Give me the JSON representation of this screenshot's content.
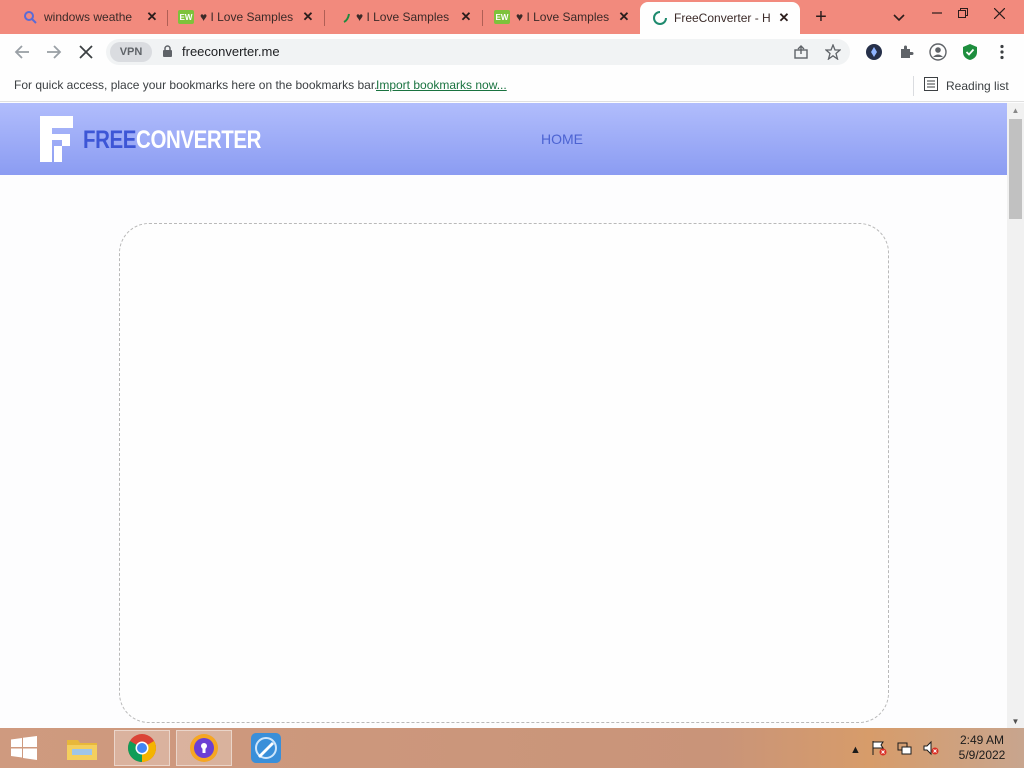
{
  "browser": {
    "tabs": [
      {
        "title": "windows weathe",
        "icon": "search-icon",
        "active": false
      },
      {
        "title": "♥ I Love Samples",
        "icon": "ew-icon",
        "badge": "EW",
        "active": false
      },
      {
        "title": "♥ I Love Samples",
        "icon": "loading-icon",
        "active": false
      },
      {
        "title": "♥ I Love Samples",
        "icon": "ew-icon",
        "badge": "EW",
        "active": false
      },
      {
        "title": "FreeConverter - H",
        "icon": "loading-icon",
        "active": true
      }
    ],
    "new_tab": "+",
    "url": "freeconverter.me",
    "vpn_label": "VPN"
  },
  "bookmarks_bar": {
    "message": "For quick access, place your bookmarks here on the bookmarks bar.",
    "import_link": "Import bookmarks now...",
    "reading_list": "Reading list"
  },
  "site": {
    "logo_free": "FREE",
    "logo_converter": "CONVERTER",
    "nav": {
      "home": "HOME"
    }
  },
  "taskbar": {
    "clock_time": "2:49 AM",
    "clock_date": "5/9/2022"
  },
  "colors": {
    "tab_strip": "#f28a7d",
    "header_gradient_top": "#b1bdfc",
    "header_gradient_bottom": "#8b9cf2",
    "logo_accent": "#3d56d6",
    "import_link": "#1a7340"
  }
}
